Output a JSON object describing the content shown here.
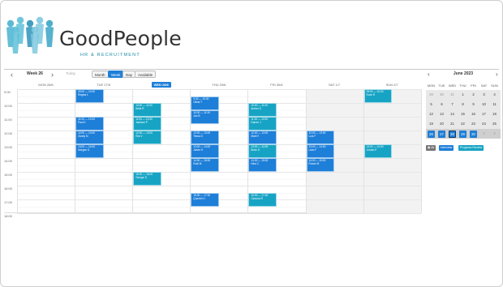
{
  "brand": {
    "name": "GoodPeople",
    "tagline": "HR & RECRUITMENT",
    "colors": [
      "#4ab3d0",
      "#5fbfd8",
      "#2e93b8",
      "#7fc9df",
      "#3aa5c6"
    ]
  },
  "toolbar": {
    "week_label": "Week 26",
    "today_label": "Today",
    "views": [
      "Month",
      "Week",
      "Day",
      "Available"
    ],
    "active_view": "Week"
  },
  "calendar": {
    "days": [
      "MON 26/6",
      "TUE 27/6",
      "WED 28/6",
      "THU 29/6",
      "FRI 30/6",
      "SAT 1/7",
      "SUN 2/7"
    ],
    "today_index": 2,
    "times": [
      "9:00",
      "10:00",
      "11:00",
      "12:00",
      "13:00",
      "14:00",
      "15:00",
      "16:00",
      "17:00",
      "18:00"
    ],
    "events": [
      {
        "day": 1,
        "start": 9.0,
        "end": 10.0,
        "time": "09:00 — 10:00",
        "name": "Regina L",
        "type": "interview"
      },
      {
        "day": 1,
        "start": 11.0,
        "end": 12.0,
        "time": "11:00 — 12:00",
        "name": "Paul K",
        "type": "interview"
      },
      {
        "day": 1,
        "start": 12.0,
        "end": 13.0,
        "time": "12:00 — 13:00",
        "name": "Zandy M",
        "type": "interview"
      },
      {
        "day": 1,
        "start": 13.0,
        "end": 14.0,
        "time": "13:00 — 14:00",
        "name": "Morgan G",
        "type": "interview"
      },
      {
        "day": 2,
        "start": 10.0,
        "end": 11.0,
        "time": "10:00 — 11:00",
        "name": "Bella R",
        "type": "progress"
      },
      {
        "day": 2,
        "start": 11.0,
        "end": 12.0,
        "time": "11:00 — 12:00",
        "name": "Jackson P",
        "type": "progress"
      },
      {
        "day": 2,
        "start": 12.0,
        "end": 13.0,
        "time": "12:00 — 13:00",
        "name": "Ella V",
        "type": "progress"
      },
      {
        "day": 2,
        "start": 15.0,
        "end": 16.0,
        "time": "15:00 — 16:00",
        "name": "George D",
        "type": "progress"
      },
      {
        "day": 3,
        "start": 9.5,
        "end": 10.5,
        "time": "9:30 — 10:30",
        "name": "Olivia T",
        "type": "interview"
      },
      {
        "day": 3,
        "start": 10.5,
        "end": 11.5,
        "time": "10:30 — 11:30",
        "name": "Jon B",
        "type": "interview"
      },
      {
        "day": 3,
        "start": 12.0,
        "end": 13.0,
        "time": "12:00 — 13:00",
        "name": "Tessa G",
        "type": "interview"
      },
      {
        "day": 3,
        "start": 13.0,
        "end": 14.0,
        "time": "13:00 — 14:00",
        "name": "Jamie H",
        "type": "interview"
      },
      {
        "day": 3,
        "start": 14.0,
        "end": 15.0,
        "time": "14:00 — 15:00",
        "name": "Rudi M",
        "type": "interview"
      },
      {
        "day": 3,
        "start": 16.5,
        "end": 17.5,
        "time": "16:30 — 17:30",
        "name": "Quentin H",
        "type": "interview"
      },
      {
        "day": 4,
        "start": 10.0,
        "end": 11.0,
        "time": "10:00 — 11:00",
        "name": "Amber G",
        "type": "progress"
      },
      {
        "day": 4,
        "start": 11.0,
        "end": 12.0,
        "time": "11:00 — 12:00",
        "name": "Darren J",
        "type": "progress"
      },
      {
        "day": 4,
        "start": 12.0,
        "end": 13.0,
        "time": "12:00 — 13:00",
        "name": "Matt H",
        "type": "interview"
      },
      {
        "day": 4,
        "start": 13.0,
        "end": 14.0,
        "time": "13:00 — 14:00",
        "name": "Brian D",
        "type": "progress"
      },
      {
        "day": 4,
        "start": 14.0,
        "end": 15.0,
        "time": "14:00 — 15:00",
        "name": "Nina C",
        "type": "interview"
      },
      {
        "day": 4,
        "start": 16.5,
        "end": 17.5,
        "time": "16:30 — 17:30",
        "name": "Gemma R",
        "type": "progress"
      },
      {
        "day": 5,
        "start": 12.0,
        "end": 13.0,
        "time": "12:00 — 13:00",
        "name": "Luis F",
        "type": "interview"
      },
      {
        "day": 5,
        "start": 13.0,
        "end": 14.0,
        "time": "13:00 — 14:00",
        "name": "Liam F",
        "type": "interview"
      },
      {
        "day": 5,
        "start": 14.0,
        "end": 15.0,
        "time": "14:00 — 15:00",
        "name": "Fraser M",
        "type": "interview"
      },
      {
        "day": 6,
        "start": 9.0,
        "end": 10.0,
        "time": "09:00 — 10:00",
        "name": "Evan R",
        "type": "progress"
      },
      {
        "day": 6,
        "start": 13.0,
        "end": 14.0,
        "time": "13:00 — 14:00",
        "name": "Jordan P",
        "type": "progress"
      }
    ]
  },
  "mini": {
    "title": "June 2023",
    "dow": [
      "MON",
      "TUE",
      "WED",
      "THU",
      "FRI",
      "SAT",
      "SUN"
    ],
    "weeks": [
      [
        "29",
        "30",
        "31",
        "1",
        "2",
        "3",
        "4"
      ],
      [
        "5",
        "6",
        "7",
        "8",
        "9",
        "10",
        "11"
      ],
      [
        "12",
        "13",
        "14",
        "15",
        "16",
        "17",
        "18"
      ],
      [
        "19",
        "20",
        "21",
        "22",
        "23",
        "24",
        "25"
      ],
      [
        "26",
        "27",
        "28",
        "29",
        "30",
        "1",
        "2"
      ]
    ],
    "current_week_index": 4,
    "selected_day": "28"
  },
  "filters": {
    "all": "All",
    "interview": "Interview",
    "progress": "Progress Review"
  },
  "colors": {
    "interview": "#1e7fd8",
    "progress": "#17a4c4",
    "all": "#777777"
  }
}
